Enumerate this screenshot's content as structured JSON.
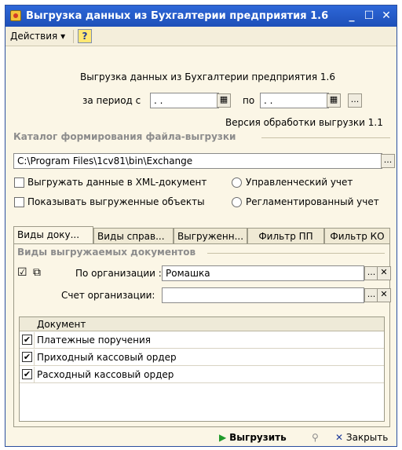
{
  "window": {
    "title": "Выгрузка данных из Бухгалтерии предприятия 1.6",
    "minimize_icon": "_",
    "maximize_icon": "☐",
    "close_icon": "✕"
  },
  "menu": {
    "actions_label": "Действия",
    "actions_arrow": "▾",
    "help_label": "?"
  },
  "header": {
    "heading": "Выгрузка данных из Бухгалтерии предприятия 1.6",
    "period_from_label": "за период с",
    "period_from_value": ". .",
    "period_to_label": "по",
    "period_to_value": ". .",
    "period_btn_label": "...",
    "version_text": "Версия обработки выгрузки 1.1"
  },
  "catalog": {
    "section_title": "Каталог формирования файла-выгрузки",
    "path_value": "C:\\Program Files\\1cv81\\bin\\Exchange",
    "browse_label": "..."
  },
  "options": {
    "export_xml_label": "Выгружать данные в XML-документ",
    "show_exported_label": "Показывать выгруженные объекты",
    "managerial_label": "Управленческий учет",
    "regulated_label": "Регламентированный учет"
  },
  "tabs": [
    {
      "label": "Виды доку..."
    },
    {
      "label": "Виды справ..."
    },
    {
      "label": "Выгруженн..."
    },
    {
      "label": "Фильтр ПП"
    },
    {
      "label": "Фильтр КО"
    }
  ],
  "tab_panel": {
    "section_title": "Виды выгружаемых документов",
    "org_label": "По организации :",
    "org_value": "Ромашка",
    "account_label": "Счет организации:",
    "account_value": "",
    "select_btn": "...",
    "clear_btn": "✕",
    "table_header": "Документ",
    "rows": [
      {
        "checked": true,
        "label": "Платежные поручения"
      },
      {
        "checked": true,
        "label": "Приходный кассовый ордер"
      },
      {
        "checked": true,
        "label": "Расходный кассовый ордер"
      }
    ]
  },
  "footer": {
    "export_label": "Выгрузить",
    "export_icon": "▶",
    "search_icon": "⚲",
    "close_icon": "✕",
    "close_label": "Закрыть"
  },
  "colors": {
    "title_bar": "#1d4fb8",
    "window_bg": "#fbf6e6",
    "accent_green": "#1f9a2a",
    "accent_blue": "#1f3b9a"
  }
}
